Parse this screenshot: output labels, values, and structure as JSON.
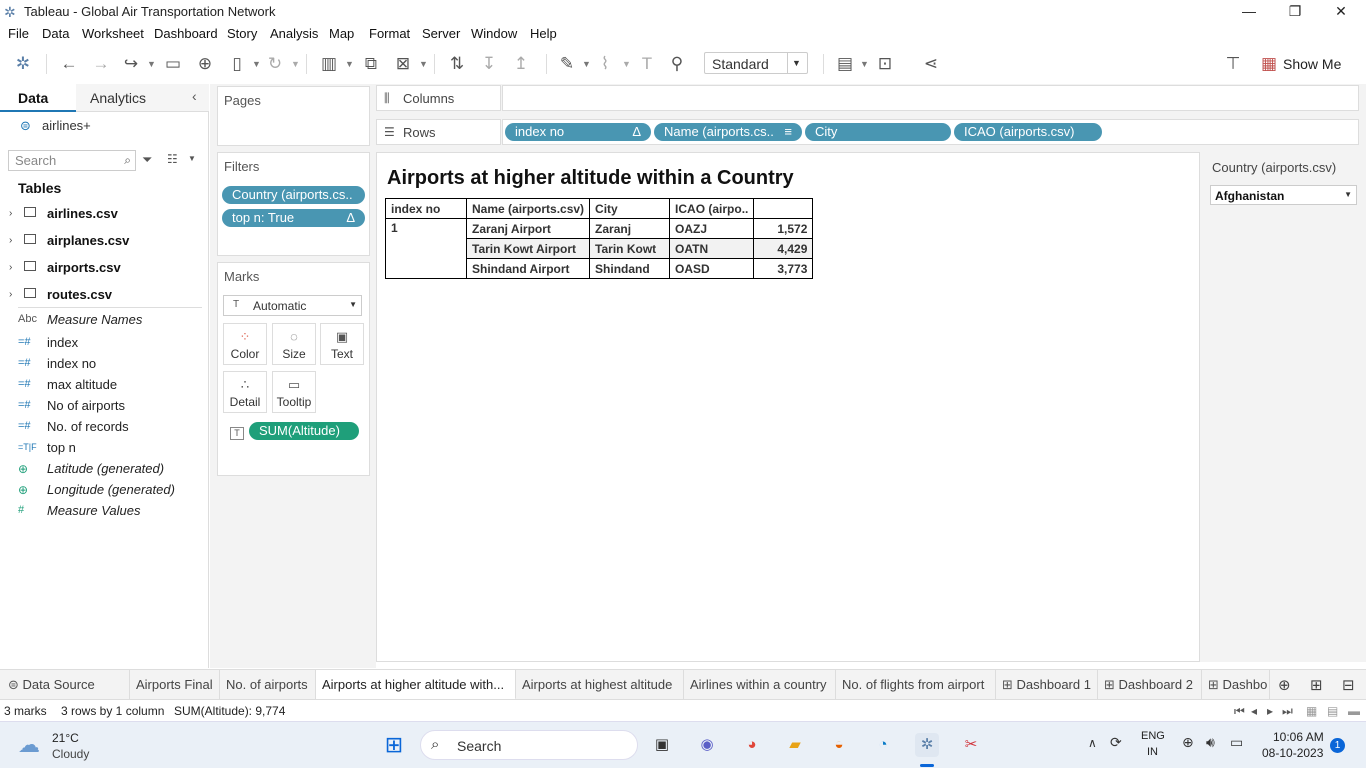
{
  "window": {
    "title": "Tableau - Global Air Transportation Network",
    "minimize": "—",
    "restore": "❐",
    "close": "✕"
  },
  "menu": [
    "File",
    "Data",
    "Worksheet",
    "Dashboard",
    "Story",
    "Analysis",
    "Map",
    "Format",
    "Server",
    "Window",
    "Help"
  ],
  "toolbar": {
    "fit": "Standard",
    "show_me": "Show Me"
  },
  "left_pane": {
    "tabs": {
      "data": "Data",
      "analytics": "Analytics"
    },
    "datasource": "airlines+",
    "search_placeholder": "Search",
    "tables_heading": "Tables",
    "tables": [
      "airlines.csv",
      "airplanes.csv",
      "airports.csv",
      "routes.csv"
    ],
    "fields": [
      {
        "icon": "Abc",
        "label": "Measure Names",
        "italic": true
      },
      {
        "icon": "=#",
        "label": "index",
        "italic": false
      },
      {
        "icon": "=#",
        "label": "index no",
        "italic": false
      },
      {
        "icon": "=#",
        "label": "max altitude",
        "italic": false
      },
      {
        "icon": "=#",
        "label": "No of airports",
        "italic": false
      },
      {
        "icon": "=#",
        "label": "No. of records",
        "italic": false
      },
      {
        "icon": "=T|F",
        "label": "top n",
        "italic": false
      },
      {
        "icon": "⊕",
        "label": "Latitude (generated)",
        "italic": true
      },
      {
        "icon": "⊕",
        "label": "Longitude (generated)",
        "italic": true
      },
      {
        "icon": "#",
        "label": "Measure Values",
        "italic": true
      }
    ]
  },
  "cards": {
    "pages": "Pages",
    "filters": "Filters",
    "filter_pills": [
      "Country (airports.cs..",
      "top n: True"
    ],
    "marks": "Marks",
    "mark_type": "Automatic",
    "mark_buttons": [
      "Color",
      "Size",
      "Text",
      "Detail",
      "Tooltip"
    ],
    "mark_pill": "SUM(Altitude)"
  },
  "shelves": {
    "columns_label": "Columns",
    "rows_label": "Rows",
    "rows_pills": [
      "index no",
      "Name (airports.cs..",
      "City",
      "ICAO (airports.csv)"
    ]
  },
  "view": {
    "title": "Airports at higher altitude within a Country",
    "headers": [
      "index no",
      "Name (airports.csv)",
      "City",
      "ICAO (airpo..",
      ""
    ],
    "index_value": "1",
    "rows": [
      {
        "name": "Zaranj Airport",
        "city": "Zaranj",
        "icao": "OAZJ",
        "altitude": "1,572"
      },
      {
        "name": "Tarin Kowt Airport",
        "city": "Tarin Kowt",
        "icao": "OATN",
        "altitude": "4,429"
      },
      {
        "name": "Shindand Airport",
        "city": "Shindand",
        "icao": "OASD",
        "altitude": "3,773"
      }
    ]
  },
  "right_pane": {
    "filter_title": "Country (airports.csv)",
    "filter_value": "Afghanistan"
  },
  "sheet_tabs": [
    "Data Source",
    "Airports Final",
    "No. of airports",
    "Airports at higher altitude with...",
    "Airports at highest altitude",
    "Airlines within a country",
    "No. of flights from airport",
    "Dashboard 1",
    "Dashboard 2",
    "Dashbo"
  ],
  "status": {
    "marks": "3 marks",
    "rows": "3 rows by 1 column",
    "sum": "SUM(Altitude): 9,774"
  },
  "taskbar": {
    "temp": "21°C",
    "weather": "Cloudy",
    "search": "Search",
    "lang1": "ENG",
    "lang2": "IN",
    "time": "10:06 AM",
    "date": "08-10-2023",
    "badge": "1"
  }
}
